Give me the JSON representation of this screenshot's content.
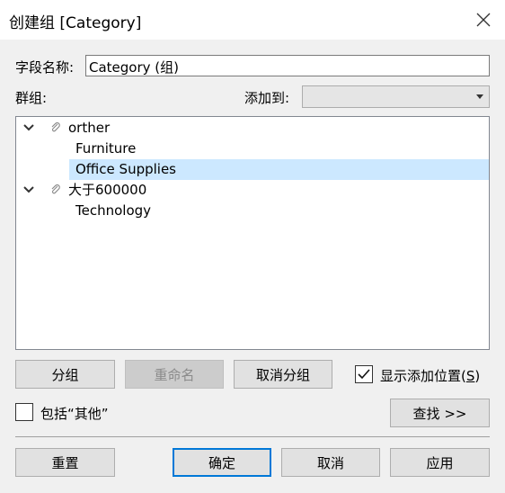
{
  "window": {
    "title": "创建组 [Category]",
    "close_glyph": "✕"
  },
  "field_name": {
    "label": "字段名称:",
    "value": "Category (组)"
  },
  "groups_label": "群组:",
  "add_to": {
    "label": "添加到:",
    "value": ""
  },
  "tree": {
    "groups": [
      {
        "name": "orther",
        "children": [
          "Furniture",
          "Office Supplies"
        ]
      },
      {
        "name": "大于600000",
        "children": [
          "Technology"
        ]
      }
    ],
    "selected": "Office Supplies"
  },
  "buttons": {
    "group": "分组",
    "rename": "重命名",
    "ungroup": "取消分组",
    "find": "查找 >>",
    "reset": "重置",
    "ok": "确定",
    "cancel": "取消",
    "apply": "应用"
  },
  "show_added_position": {
    "label_main": "显示添加位置(",
    "mnemonic": "S",
    "label_end": ")",
    "checked": true
  },
  "include_other": {
    "label": "包括“其他”",
    "checked": false
  }
}
